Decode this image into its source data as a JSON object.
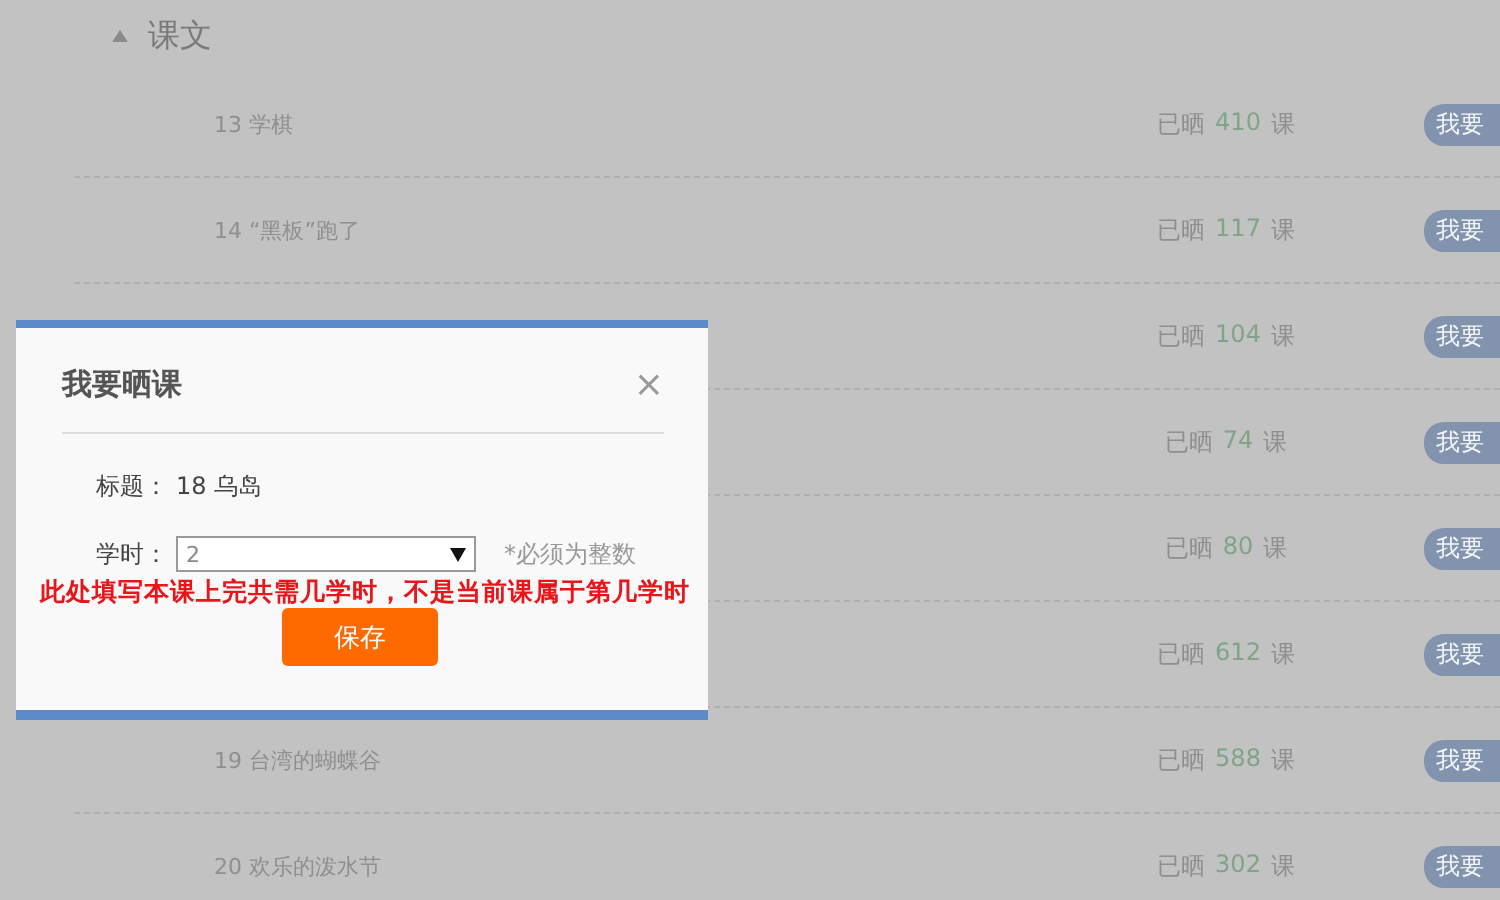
{
  "section": {
    "title": "课文",
    "expanded": true
  },
  "lessons": [
    {
      "title": "13 学棋",
      "count_prefix": "已晒",
      "count": "410",
      "count_suffix": "课",
      "action": "我要"
    },
    {
      "title": "14 “黑板”跑了",
      "count_prefix": "已晒",
      "count": "117",
      "count_suffix": "课",
      "action": "我要"
    },
    {
      "count_prefix": "已晒",
      "count": "104",
      "count_suffix": "课",
      "action": "我要"
    },
    {
      "count_prefix": "已晒",
      "count": "74",
      "count_suffix": "课",
      "action": "我要"
    },
    {
      "count_prefix": "已晒",
      "count": "80",
      "count_suffix": "课",
      "action": "我要"
    },
    {
      "count_prefix": "已晒",
      "count": "612",
      "count_suffix": "课",
      "action": "我要"
    },
    {
      "title": "19 台湾的蝴蝶谷",
      "count_prefix": "已晒",
      "count": "588",
      "count_suffix": "课",
      "action": "我要"
    },
    {
      "title": "20 欢乐的泼水节",
      "count_prefix": "已晒",
      "count": "302",
      "count_suffix": "课",
      "action": "我要"
    }
  ],
  "dialog": {
    "title": "我要晒课",
    "close": "×",
    "title_label": "标题：",
    "title_value": "18 乌岛",
    "hours_label": "学时：",
    "hours_value": "2",
    "hours_hint": "*必须为整数",
    "warning": "此处填写本课上完共需几学时，不是当前课属于第几学时",
    "save": "保存"
  }
}
